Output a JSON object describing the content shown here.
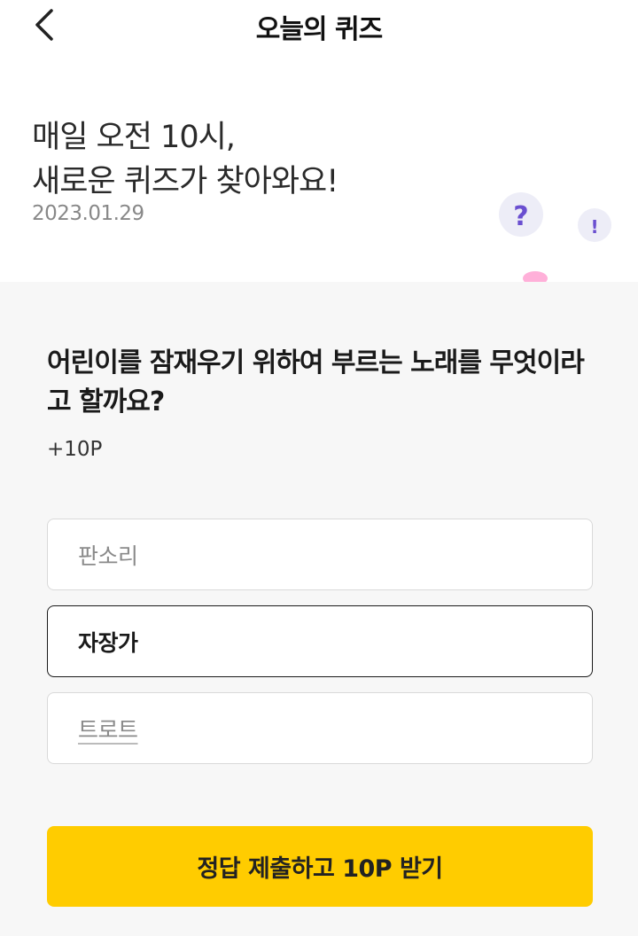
{
  "header": {
    "title": "오늘의 퀴즈",
    "back_icon": "chevron-left-icon"
  },
  "hero": {
    "headline_line1": "매일 오전 10시,",
    "headline_line2": "새로운 퀴즈가 찾아와요!",
    "date": "2023.01.29",
    "mascot_bubble_question": "?",
    "mascot_bubble_exclaim": "!"
  },
  "quiz": {
    "question": "어린이를 잠재우기 위하여 부르는 노래를 무엇이라고 할까요?",
    "points": "+10P",
    "options": [
      {
        "label": "판소리",
        "selected": false
      },
      {
        "label": "자장가",
        "selected": true
      },
      {
        "label": "트로트",
        "selected": false
      }
    ],
    "submit_label": "정답 제출하고 10P 받기"
  },
  "colors": {
    "accent": "#ffcc00",
    "mascot": "#ff0a8c",
    "background": "#f7f7f7"
  }
}
